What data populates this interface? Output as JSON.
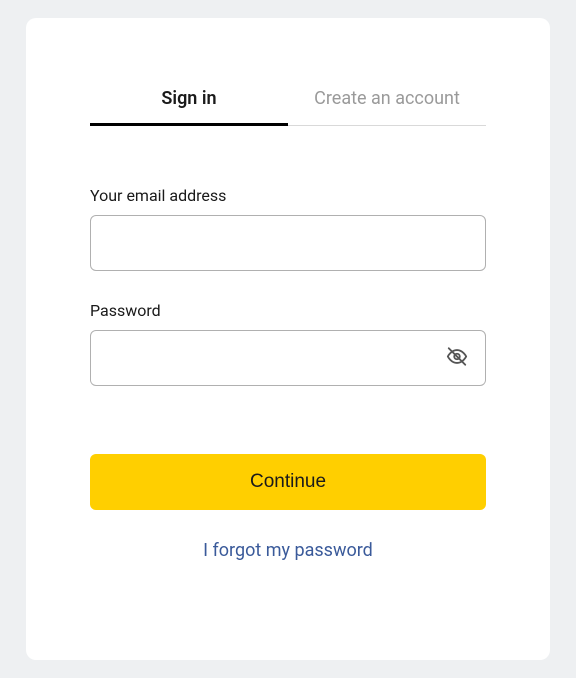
{
  "tabs": {
    "signin": "Sign in",
    "create": "Create an account"
  },
  "form": {
    "email_label": "Your email address",
    "email_value": "",
    "password_label": "Password",
    "password_value": "",
    "continue_label": "Continue",
    "forgot_label": "I forgot my password"
  },
  "colors": {
    "primary": "#ffcf00",
    "link": "#3a5a9a"
  }
}
